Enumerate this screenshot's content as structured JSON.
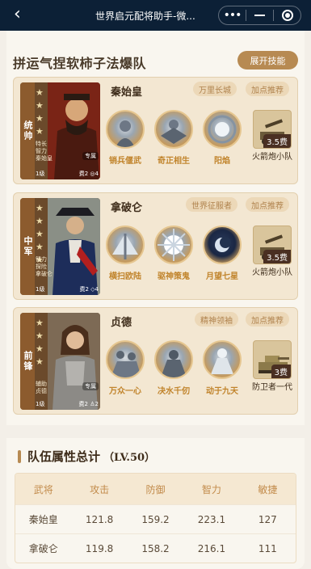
{
  "window": {
    "title": "世界启元配将助手-微...",
    "back_icon": "back-chevron-icon",
    "more_icon": "more-dots-icon",
    "minimize_icon": "minimize-icon",
    "close_icon": "target-close-icon"
  },
  "lineup": {
    "title": "拼运气捏软柿子法爆队",
    "expand_label": "展开技能"
  },
  "generals": [
    {
      "position": "统帅",
      "name": "秦始皇",
      "tags": [
        "万里长城",
        "加点推荐"
      ],
      "portrait_lines": [
        "特长",
        "智力",
        "秦始皇"
      ],
      "specialty": "专属",
      "level": "1级",
      "cost": "费2",
      "extra": "4",
      "skills": [
        "销兵偃武",
        "奇正相生",
        "阳焰"
      ],
      "unit": {
        "name": "火箭炮小队",
        "cost": "3.5费"
      }
    },
    {
      "position": "中军",
      "name": "拿破仑",
      "tags": [
        "世界征服者",
        "加点推荐"
      ],
      "portrait_lines": [
        "智力",
        "探险",
        "拿破仑"
      ],
      "specialty": "",
      "level": "1级",
      "cost": "费2",
      "extra": "4",
      "skills": [
        "横扫欧陆",
        "驱神策鬼",
        "月望七星"
      ],
      "unit": {
        "name": "火箭炮小队",
        "cost": "3.5费"
      }
    },
    {
      "position": "前锋",
      "name": "贞德",
      "tags": [
        "精神领袖",
        "加点推荐"
      ],
      "portrait_lines": [
        "辅助",
        "贞德"
      ],
      "specialty": "专属",
      "level": "1级",
      "cost": "费2",
      "extra": "2",
      "skills": [
        "万众一心",
        "决水千仞",
        "动于九天"
      ],
      "unit": {
        "name": "防卫者一代",
        "cost": "3费"
      }
    }
  ],
  "stats": {
    "title": "队伍属性总计",
    "level": "（LV.50）",
    "headers": [
      "武将",
      "攻击",
      "防御",
      "智力",
      "敏捷"
    ],
    "rows": [
      [
        "秦始皇",
        "121.8",
        "159.2",
        "223.1",
        "127"
      ],
      [
        "拿破仑",
        "119.8",
        "158.2",
        "216.1",
        "111"
      ]
    ]
  },
  "colors": {
    "nav_bg": "#0c2036",
    "accent": "#b78a52",
    "card_bg": "#f3e7d2",
    "skill_label": "#c1842c"
  }
}
